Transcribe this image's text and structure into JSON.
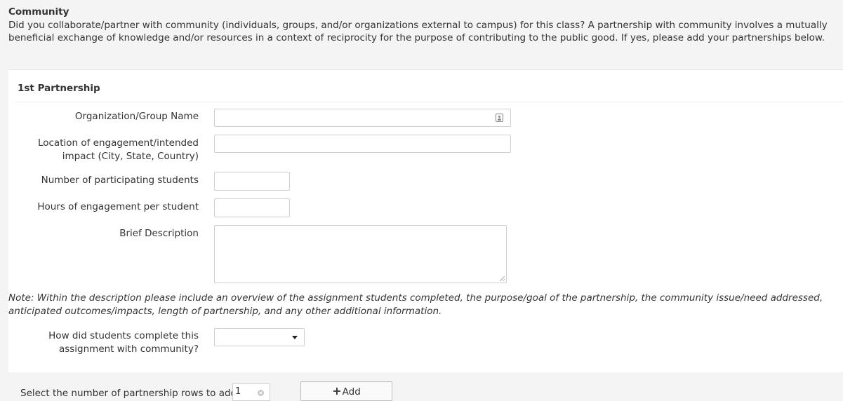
{
  "intro": {
    "title": "Community",
    "text": "Did you collaborate/partner with community (individuals, groups, and/or organizations external to campus) for this class? A partnership with community involves a mutually beneficial exchange of knowledge and/or resources in a context of reciprocity for the purpose of contributing to the public good. If yes, please add your partnerships below."
  },
  "partnership": {
    "heading": "1st Partnership",
    "fields": {
      "org_name": {
        "label": "Organization/Group Name",
        "value": ""
      },
      "location": {
        "label": "Location of engagement/intended impact (City, State, Country)",
        "value": ""
      },
      "num_students": {
        "label": "Number of participating students",
        "value": ""
      },
      "hours": {
        "label": "Hours of engagement per student",
        "value": ""
      },
      "description": {
        "label": "Brief Description",
        "value": ""
      }
    },
    "note": "Note: Within the description please include an overview of the assignment students completed, the purpose/goal of the partnership, the community issue/need addressed, anticipated outcomes/impacts, length of partnership, and any other additional information.",
    "completion": {
      "label": "How did students complete this assignment with community?",
      "selected": ""
    }
  },
  "footer": {
    "rows_label": "Select the number of partnership rows to add:",
    "rows_value": "1",
    "add_label": "Add",
    "add_icon": "plus-icon"
  }
}
